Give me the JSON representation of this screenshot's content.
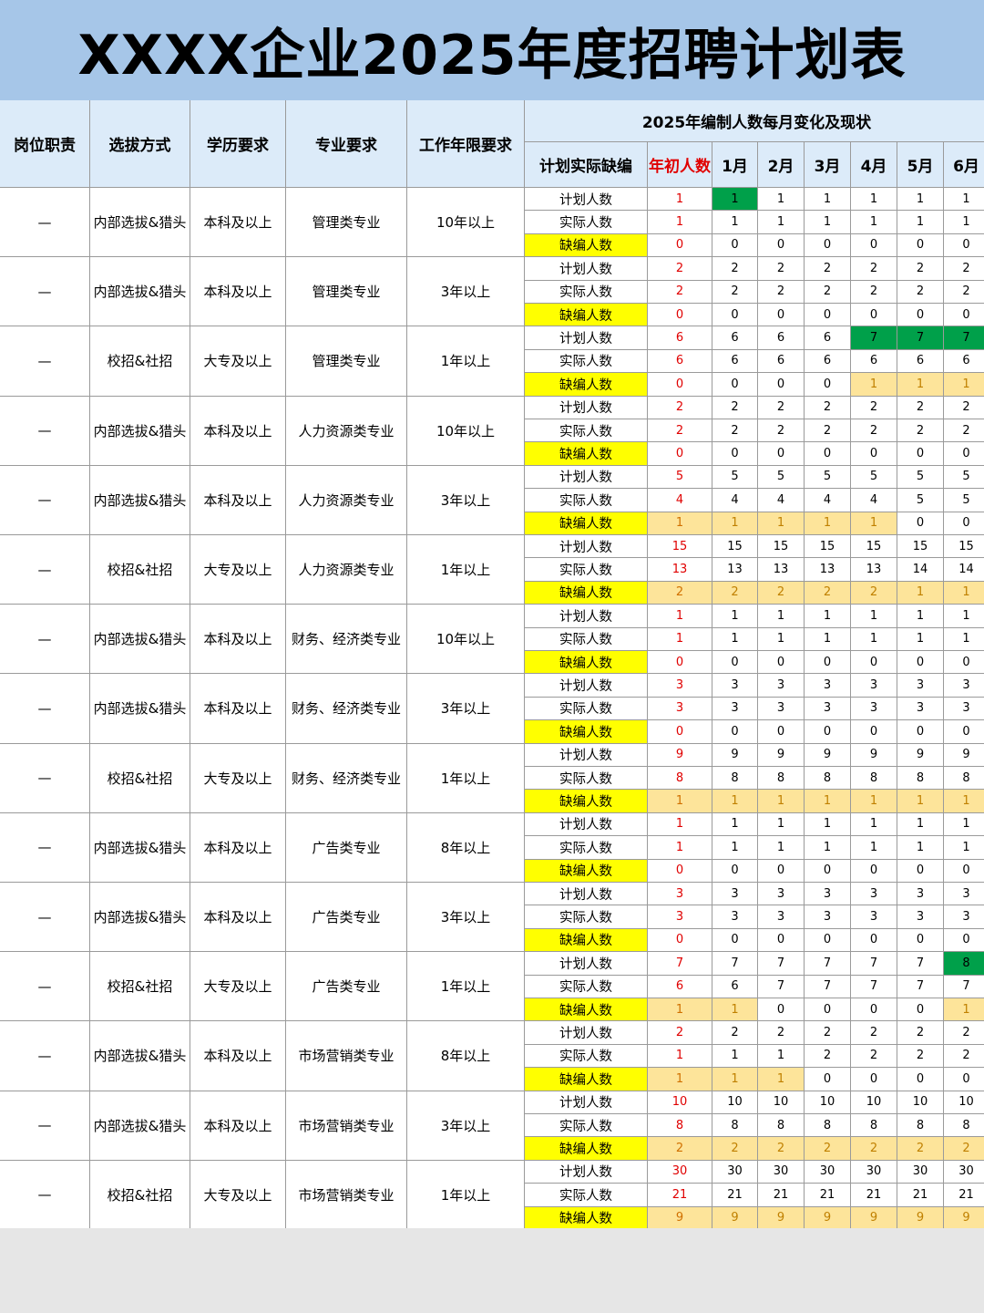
{
  "title": "XXXX企业2025年度招聘计划表",
  "headers": {
    "duty": "岗位职责",
    "method": "选拔方式",
    "education": "学历要求",
    "major": "专业要求",
    "experience": "工作年限要求",
    "monthly_title": "2025年编制人数每月变化及现状",
    "gap_label": "计划实际缺编",
    "start_count": "年初人数",
    "months": [
      "1月",
      "2月",
      "3月",
      "4月",
      "5月",
      "6月"
    ]
  },
  "row_labels": [
    "计划人数",
    "实际人数",
    "缺编人数"
  ],
  "groups": [
    {
      "duty": "—",
      "method": "内部选拔&猎头",
      "education": "本科及以上",
      "major": "管理类专业",
      "experience": "10年以上",
      "plan": [
        1,
        1,
        1,
        1,
        1,
        1,
        1
      ],
      "actual": [
        1,
        1,
        1,
        1,
        1,
        1,
        1
      ],
      "shortage": [
        0,
        0,
        0,
        0,
        0,
        0,
        0
      ]
    },
    {
      "duty": "—",
      "method": "内部选拔&猎头",
      "education": "本科及以上",
      "major": "管理类专业",
      "experience": "3年以上",
      "plan": [
        2,
        2,
        2,
        2,
        2,
        2,
        2
      ],
      "actual": [
        2,
        2,
        2,
        2,
        2,
        2,
        2
      ],
      "shortage": [
        0,
        0,
        0,
        0,
        0,
        0,
        0
      ]
    },
    {
      "duty": "—",
      "method": "校招&社招",
      "education": "大专及以上",
      "major": "管理类专业",
      "experience": "1年以上",
      "plan": [
        6,
        6,
        6,
        6,
        7,
        7,
        7
      ],
      "actual": [
        6,
        6,
        6,
        6,
        6,
        6,
        6
      ],
      "shortage": [
        0,
        0,
        0,
        0,
        1,
        1,
        1
      ]
    },
    {
      "duty": "—",
      "method": "内部选拔&猎头",
      "education": "本科及以上",
      "major": "人力资源类专业",
      "experience": "10年以上",
      "plan": [
        2,
        2,
        2,
        2,
        2,
        2,
        2
      ],
      "actual": [
        2,
        2,
        2,
        2,
        2,
        2,
        2
      ],
      "shortage": [
        0,
        0,
        0,
        0,
        0,
        0,
        0
      ]
    },
    {
      "duty": "—",
      "method": "内部选拔&猎头",
      "education": "本科及以上",
      "major": "人力资源类专业",
      "experience": "3年以上",
      "plan": [
        5,
        5,
        5,
        5,
        5,
        5,
        5
      ],
      "actual": [
        4,
        4,
        4,
        4,
        4,
        5,
        5
      ],
      "shortage": [
        1,
        1,
        1,
        1,
        1,
        0,
        0
      ]
    },
    {
      "duty": "—",
      "method": "校招&社招",
      "education": "大专及以上",
      "major": "人力资源类专业",
      "experience": "1年以上",
      "plan": [
        15,
        15,
        15,
        15,
        15,
        15,
        15
      ],
      "actual": [
        13,
        13,
        13,
        13,
        13,
        14,
        14
      ],
      "shortage": [
        2,
        2,
        2,
        2,
        2,
        1,
        1
      ]
    },
    {
      "duty": "—",
      "method": "内部选拔&猎头",
      "education": "本科及以上",
      "major": "财务、经济类专业",
      "experience": "10年以上",
      "plan": [
        1,
        1,
        1,
        1,
        1,
        1,
        1
      ],
      "actual": [
        1,
        1,
        1,
        1,
        1,
        1,
        1
      ],
      "shortage": [
        0,
        0,
        0,
        0,
        0,
        0,
        0
      ]
    },
    {
      "duty": "—",
      "method": "内部选拔&猎头",
      "education": "本科及以上",
      "major": "财务、经济类专业",
      "experience": "3年以上",
      "plan": [
        3,
        3,
        3,
        3,
        3,
        3,
        3
      ],
      "actual": [
        3,
        3,
        3,
        3,
        3,
        3,
        3
      ],
      "shortage": [
        0,
        0,
        0,
        0,
        0,
        0,
        0
      ]
    },
    {
      "duty": "—",
      "method": "校招&社招",
      "education": "大专及以上",
      "major": "财务、经济类专业",
      "experience": "1年以上",
      "plan": [
        9,
        9,
        9,
        9,
        9,
        9,
        9
      ],
      "actual": [
        8,
        8,
        8,
        8,
        8,
        8,
        8
      ],
      "shortage": [
        1,
        1,
        1,
        1,
        1,
        1,
        1
      ]
    },
    {
      "duty": "—",
      "method": "内部选拔&猎头",
      "education": "本科及以上",
      "major": "广告类专业",
      "experience": "8年以上",
      "plan": [
        1,
        1,
        1,
        1,
        1,
        1,
        1
      ],
      "actual": [
        1,
        1,
        1,
        1,
        1,
        1,
        1
      ],
      "shortage": [
        0,
        0,
        0,
        0,
        0,
        0,
        0
      ]
    },
    {
      "duty": "—",
      "method": "内部选拔&猎头",
      "education": "本科及以上",
      "major": "广告类专业",
      "experience": "3年以上",
      "plan": [
        3,
        3,
        3,
        3,
        3,
        3,
        3
      ],
      "actual": [
        3,
        3,
        3,
        3,
        3,
        3,
        3
      ],
      "shortage": [
        0,
        0,
        0,
        0,
        0,
        0,
        0
      ]
    },
    {
      "duty": "—",
      "method": "校招&社招",
      "education": "大专及以上",
      "major": "广告类专业",
      "experience": "1年以上",
      "plan": [
        7,
        7,
        7,
        7,
        7,
        7,
        8
      ],
      "actual": [
        6,
        6,
        7,
        7,
        7,
        7,
        7
      ],
      "shortage": [
        1,
        1,
        0,
        0,
        0,
        0,
        1
      ]
    },
    {
      "duty": "—",
      "method": "内部选拔&猎头",
      "education": "本科及以上",
      "major": "市场营销类专业",
      "experience": "8年以上",
      "plan": [
        2,
        2,
        2,
        2,
        2,
        2,
        2
      ],
      "actual": [
        1,
        1,
        1,
        2,
        2,
        2,
        2
      ],
      "shortage": [
        1,
        1,
        1,
        0,
        0,
        0,
        0
      ]
    },
    {
      "duty": "—",
      "method": "内部选拔&猎头",
      "education": "本科及以上",
      "major": "市场营销类专业",
      "experience": "3年以上",
      "plan": [
        10,
        10,
        10,
        10,
        10,
        10,
        10
      ],
      "actual": [
        8,
        8,
        8,
        8,
        8,
        8,
        8
      ],
      "shortage": [
        2,
        2,
        2,
        2,
        2,
        2,
        2
      ]
    },
    {
      "duty": "—",
      "method": "校招&社招",
      "education": "大专及以上",
      "major": "市场营销类专业",
      "experience": "1年以上",
      "plan": [
        30,
        30,
        30,
        30,
        30,
        30,
        30
      ],
      "actual": [
        21,
        21,
        21,
        21,
        21,
        21,
        21
      ],
      "shortage": [
        9,
        9,
        9,
        9,
        9,
        9,
        9
      ]
    }
  ],
  "highlights": {
    "green_color": "#00a04a",
    "tan_color": "#fde49a",
    "yellow_color": "#ffff00",
    "red_text_color": "#e00000",
    "green_plan_cells": [
      [
        0,
        1
      ],
      [
        2,
        4
      ],
      [
        2,
        5
      ],
      [
        2,
        6
      ],
      [
        11,
        6
      ]
    ]
  }
}
